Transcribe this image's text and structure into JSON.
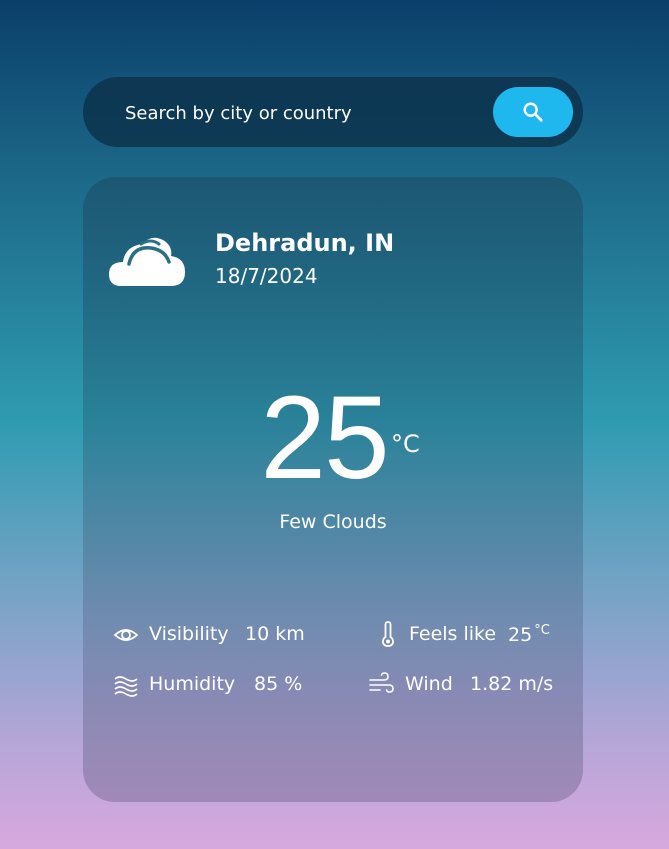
{
  "search": {
    "placeholder": "Search by city or country",
    "button_icon": "search-icon"
  },
  "weather": {
    "icon": "cloud-icon",
    "city": "Dehradun, IN",
    "date": "18/7/2024",
    "temperature": "25",
    "unit": "°C",
    "condition": "Few Clouds"
  },
  "details": {
    "visibility": {
      "icon": "eye-icon",
      "label": "Visibility",
      "value": "10 km"
    },
    "feels_like": {
      "icon": "thermometer-icon",
      "label": "Feels like",
      "value": "25",
      "unit": "°C"
    },
    "humidity": {
      "icon": "humidity-waves-icon",
      "label": "Humidity",
      "value": "85 %"
    },
    "wind": {
      "icon": "wind-icon",
      "label": "Wind",
      "value": "1.82 m/s"
    }
  },
  "colors": {
    "accent": "#1fb8ee",
    "search_bar": "#0c3048",
    "text": "#ffffff"
  }
}
